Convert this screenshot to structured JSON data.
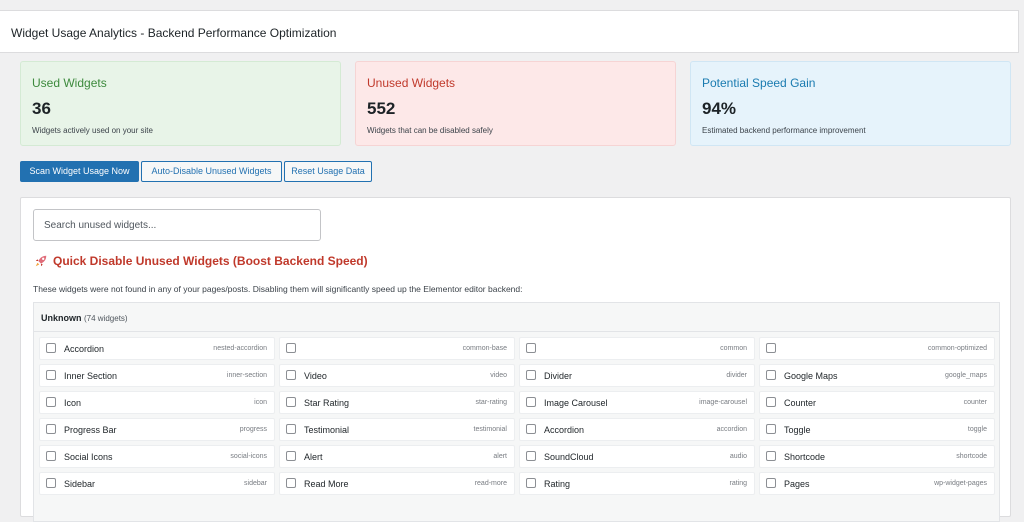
{
  "header": {
    "title": "Widget Usage Analytics - Backend Performance Optimization"
  },
  "stats": [
    {
      "title": "Used Widgets",
      "value": "36",
      "desc": "Widgets actively used on your site"
    },
    {
      "title": "Unused Widgets",
      "value": "552",
      "desc": "Widgets that can be disabled safely"
    },
    {
      "title": "Potential Speed Gain",
      "value": "94%",
      "desc": "Estimated backend performance improvement"
    }
  ],
  "buttons": {
    "scan": "Scan Widget Usage Now",
    "auto_disable": "Auto-Disable Unused Widgets",
    "reset": "Reset Usage Data"
  },
  "search": {
    "placeholder": "Search unused widgets..."
  },
  "quick_disable": {
    "title": "Quick Disable Unused Widgets (Boost Backend Speed)",
    "description": "These widgets were not found in any of your pages/posts. Disabling them will significantly speed up the Elementor editor backend:"
  },
  "group": {
    "name": "Unknown",
    "count": "(74 widgets)"
  },
  "colors": {
    "primary": "#2271b1",
    "used": "#3d8a3d",
    "unused": "#c0392b",
    "gain": "#1a7bb0"
  },
  "widgets": [
    {
      "label": "Accordion",
      "slug": "nested-accordion"
    },
    {
      "label": "",
      "slug": "common-base"
    },
    {
      "label": "",
      "slug": "common"
    },
    {
      "label": "",
      "slug": "common-optimized"
    },
    {
      "label": "Inner Section",
      "slug": "inner-section"
    },
    {
      "label": "Video",
      "slug": "video"
    },
    {
      "label": "Divider",
      "slug": "divider"
    },
    {
      "label": "Google Maps",
      "slug": "google_maps"
    },
    {
      "label": "Icon",
      "slug": "icon"
    },
    {
      "label": "Star Rating",
      "slug": "star-rating"
    },
    {
      "label": "Image Carousel",
      "slug": "image-carousel"
    },
    {
      "label": "Counter",
      "slug": "counter"
    },
    {
      "label": "Progress Bar",
      "slug": "progress"
    },
    {
      "label": "Testimonial",
      "slug": "testimonial"
    },
    {
      "label": "Accordion",
      "slug": "accordion"
    },
    {
      "label": "Toggle",
      "slug": "toggle"
    },
    {
      "label": "Social Icons",
      "slug": "social-icons"
    },
    {
      "label": "Alert",
      "slug": "alert"
    },
    {
      "label": "SoundCloud",
      "slug": "audio"
    },
    {
      "label": "Shortcode",
      "slug": "shortcode"
    },
    {
      "label": "Sidebar",
      "slug": "sidebar"
    },
    {
      "label": "Read More",
      "slug": "read-more"
    },
    {
      "label": "Rating",
      "slug": "rating"
    },
    {
      "label": "Pages",
      "slug": "wp-widget-pages"
    }
  ]
}
